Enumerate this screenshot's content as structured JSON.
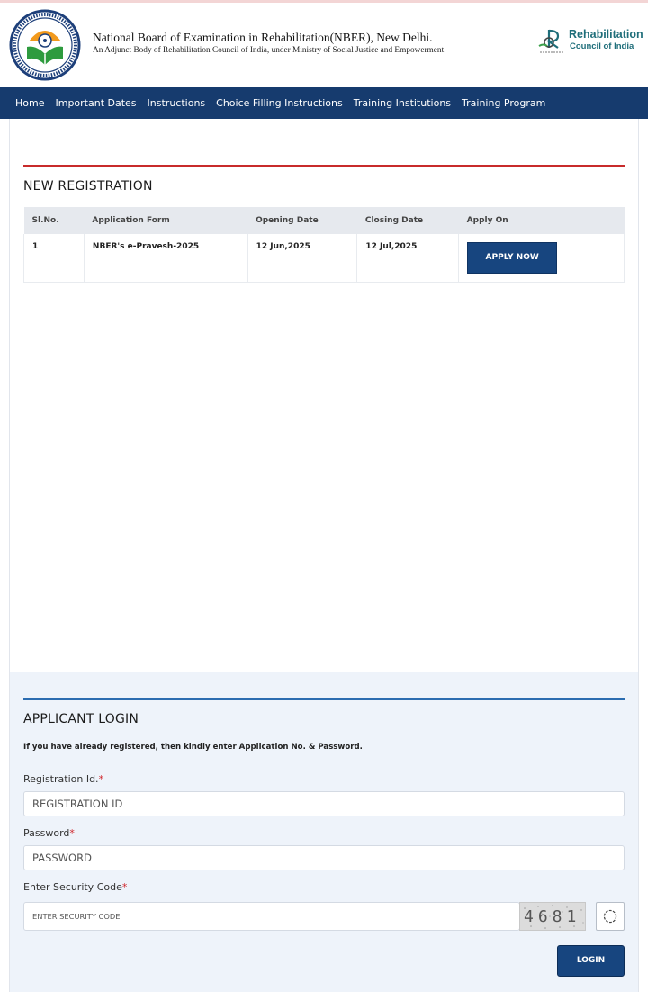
{
  "header": {
    "title": "National Board of Examination in Rehabilitation(NBER), New Delhi.",
    "subtitle": "An Adjunct Body of Rehabilitation Council of India, under Ministry of Social Justice and Empowerment",
    "rci_name_line1": "Rehabilitation",
    "rci_name_line2": "Council of India",
    "logo_icon": "nber-emblem-icon",
    "rci_icon": "rci-logo-icon"
  },
  "nav": {
    "items": [
      {
        "label": "Home"
      },
      {
        "label": "Important Dates"
      },
      {
        "label": "Instructions"
      },
      {
        "label": "Choice Filling Instructions"
      },
      {
        "label": "Training Institutions"
      },
      {
        "label": "Training Program"
      }
    ]
  },
  "registration": {
    "title": "NEW REGISTRATION",
    "columns": [
      "Sl.No.",
      "Application Form",
      "Opening Date",
      "Closing Date",
      "Apply On"
    ],
    "rows": [
      {
        "sl": "1",
        "form": "NBER's e-Pravesh-2025",
        "opening": "12 Jun,2025",
        "closing": "12 Jul,2025",
        "action": "APPLY NOW"
      }
    ]
  },
  "login": {
    "title": "APPLICANT LOGIN",
    "note": "If you have already registered, then kindly enter Application No. & Password.",
    "reg_label": "Registration Id.",
    "reg_placeholder": "REGISTRATION ID",
    "password_label": "Password",
    "password_placeholder": "PASSWORD",
    "security_label": "Enter Security Code",
    "security_placeholder": "ENTER SECURITY CODE",
    "required_mark": "*",
    "captcha": "4681",
    "button": "LOGIN",
    "refresh_icon": "refresh-icon"
  },
  "colors": {
    "nav_bg": "#163b6e",
    "button_bg": "#17457f",
    "registration_rule": "#c82b2b",
    "login_rule": "#2b6cb0",
    "login_panel_bg": "#eef3fa",
    "required": "#d0262b"
  }
}
